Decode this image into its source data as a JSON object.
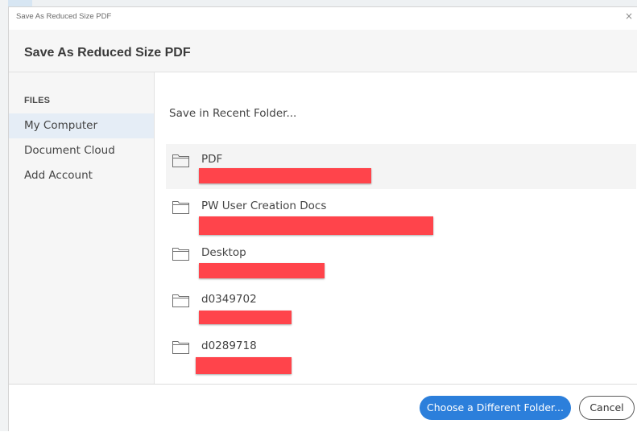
{
  "window": {
    "title": "Save As Reduced Size PDF",
    "close_glyph": "×"
  },
  "header": {
    "title": "Save As Reduced Size PDF"
  },
  "sidebar": {
    "heading": "FILES",
    "items": [
      {
        "label": "My Computer",
        "active": true
      },
      {
        "label": "Document Cloud",
        "active": false
      },
      {
        "label": "Add Account",
        "active": false
      }
    ]
  },
  "main": {
    "recent_label": "Save in Recent Folder...",
    "folders": [
      {
        "name": "PDF",
        "icon": "folder-icon"
      },
      {
        "name": "PW User Creation Docs",
        "icon": "folder-icon"
      },
      {
        "name": "Desktop",
        "icon": "folder-icon"
      },
      {
        "name": "d0349702",
        "icon": "folder-icon"
      },
      {
        "name": "d0289718",
        "icon": "folder-icon"
      }
    ],
    "redaction_color": "#ff444b"
  },
  "footer": {
    "primary_label": "Choose a Different Folder...",
    "cancel_label": "Cancel",
    "primary_color": "#2c7fdb"
  }
}
